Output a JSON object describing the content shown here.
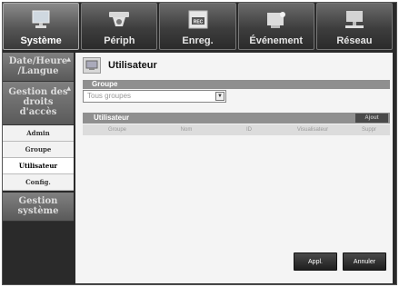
{
  "nav": {
    "tabs": [
      {
        "label": "Système",
        "icon": "monitor-icon",
        "active": true
      },
      {
        "label": "Périph",
        "icon": "camera-icon",
        "active": false
      },
      {
        "label": "Enreg.",
        "icon": "rec-icon",
        "active": false
      },
      {
        "label": "Événement",
        "icon": "event-sensor-icon",
        "active": false
      },
      {
        "label": "Réseau",
        "icon": "network-icon",
        "active": false
      }
    ]
  },
  "sidebar": {
    "date": {
      "line1": "Date/Heure",
      "line2": "/Langue"
    },
    "gestion": {
      "line1": "Gestion des",
      "line2": "droits",
      "line3": "d'accès"
    },
    "sub": [
      "Admin",
      "Groupe",
      "Utilisateur",
      "Config."
    ],
    "systeme": {
      "line1": "Gestion",
      "line2": "système"
    }
  },
  "main": {
    "title": "Utilisateur",
    "group_header": "Groupe",
    "group_select": "Tous groupes",
    "user_header": "Utilisateur",
    "add_button": "Ajout",
    "columns": [
      "Groupe",
      "Nom",
      "ID",
      "Visualisateur",
      "Suppr"
    ]
  },
  "footer": {
    "apply": "Appl.",
    "cancel": "Annuler"
  }
}
